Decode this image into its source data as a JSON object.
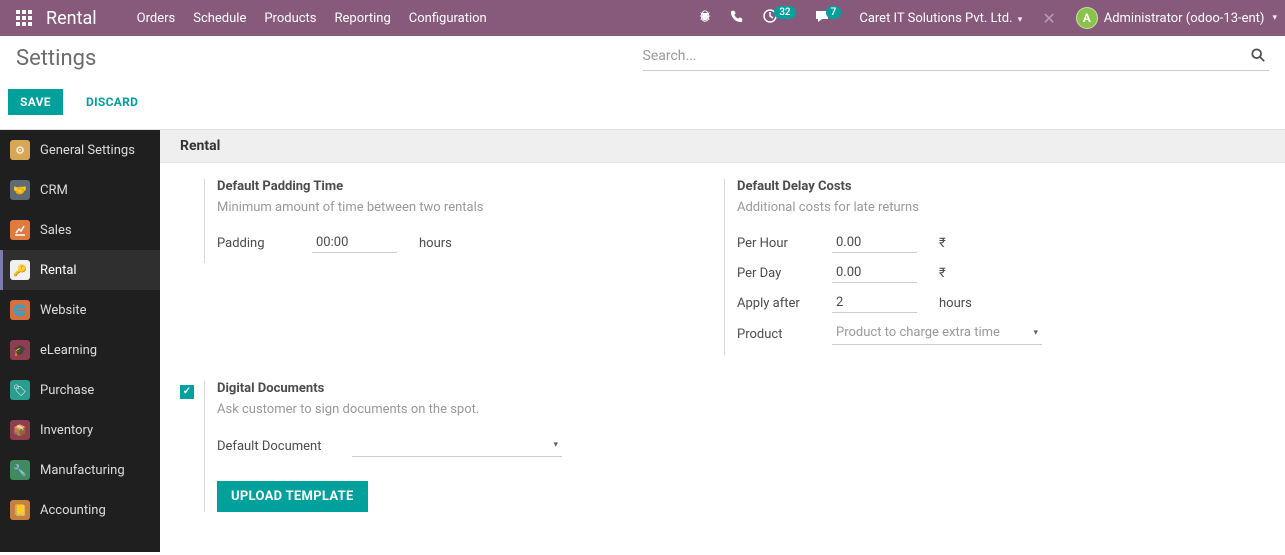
{
  "topbar": {
    "app_title": "Rental",
    "nav": [
      "Orders",
      "Schedule",
      "Products",
      "Reporting",
      "Configuration"
    ],
    "badge_activities": "32",
    "badge_messages": "7",
    "company": "Caret IT Solutions Pvt. Ltd.",
    "user": "Administrator (odoo-13-ent)"
  },
  "subheader": {
    "title": "Settings",
    "search_placeholder": "Search..."
  },
  "actions": {
    "save": "SAVE",
    "discard": "DISCARD"
  },
  "sidebar": {
    "items": [
      {
        "label": "General Settings"
      },
      {
        "label": "CRM"
      },
      {
        "label": "Sales"
      },
      {
        "label": "Rental"
      },
      {
        "label": "Website"
      },
      {
        "label": "eLearning"
      },
      {
        "label": "Purchase"
      },
      {
        "label": "Inventory"
      },
      {
        "label": "Manufacturing"
      },
      {
        "label": "Accounting"
      }
    ]
  },
  "section": {
    "title": "Rental",
    "padding": {
      "title": "Default Padding Time",
      "desc": "Minimum amount of time between two rentals",
      "label": "Padding",
      "value": "00:00",
      "unit": "hours"
    },
    "delay": {
      "title": "Default Delay Costs",
      "desc": "Additional costs for late returns",
      "per_hour_label": "Per Hour",
      "per_hour_value": "0.00",
      "per_day_label": "Per Day",
      "per_day_value": "0.00",
      "currency": "₹",
      "apply_after_label": "Apply after",
      "apply_after_value": "2",
      "apply_after_unit": "hours",
      "product_label": "Product",
      "product_placeholder": "Product to charge extra time"
    },
    "docs": {
      "title": "Digital Documents",
      "desc": "Ask customer to sign documents on the spot.",
      "template_label": "Default Document",
      "upload": "UPLOAD TEMPLATE",
      "checked": true
    }
  }
}
